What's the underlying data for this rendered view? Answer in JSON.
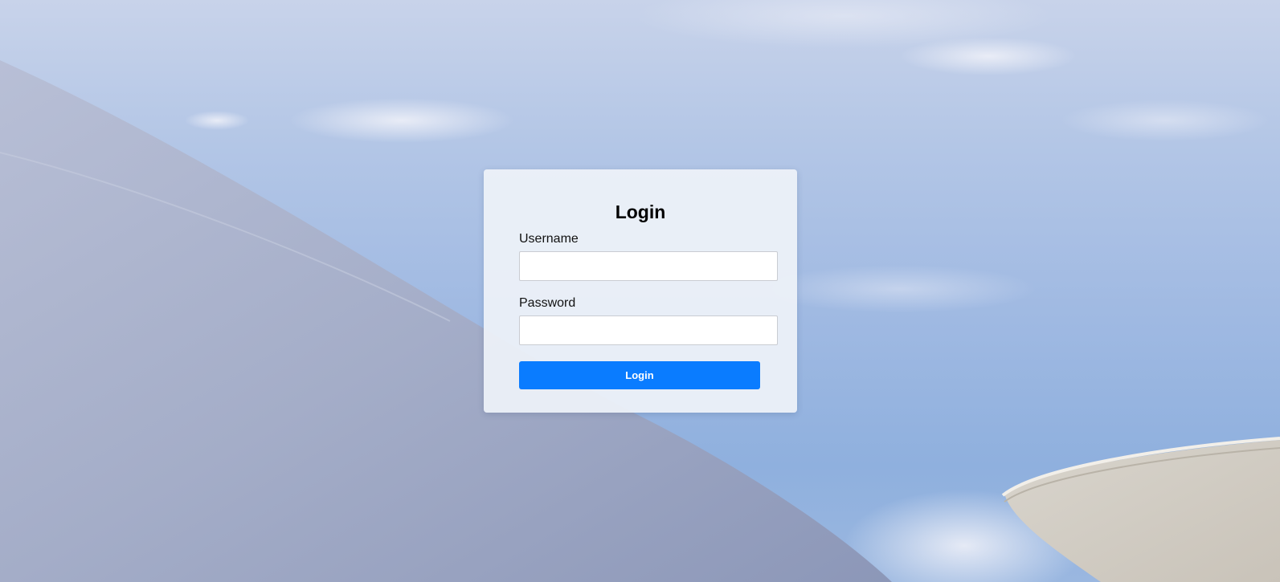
{
  "login": {
    "title": "Login",
    "username_label": "Username",
    "username_value": "",
    "password_label": "Password",
    "password_value": "",
    "submit_label": "Login"
  },
  "colors": {
    "accent": "#0a7cff",
    "card_background": "#eef2f9",
    "sky": "#a8bfe4",
    "dome": "#a9b2cc",
    "building_right": "#d3cec6"
  },
  "background": {
    "description_icon": "sky-with-domes-photo"
  }
}
